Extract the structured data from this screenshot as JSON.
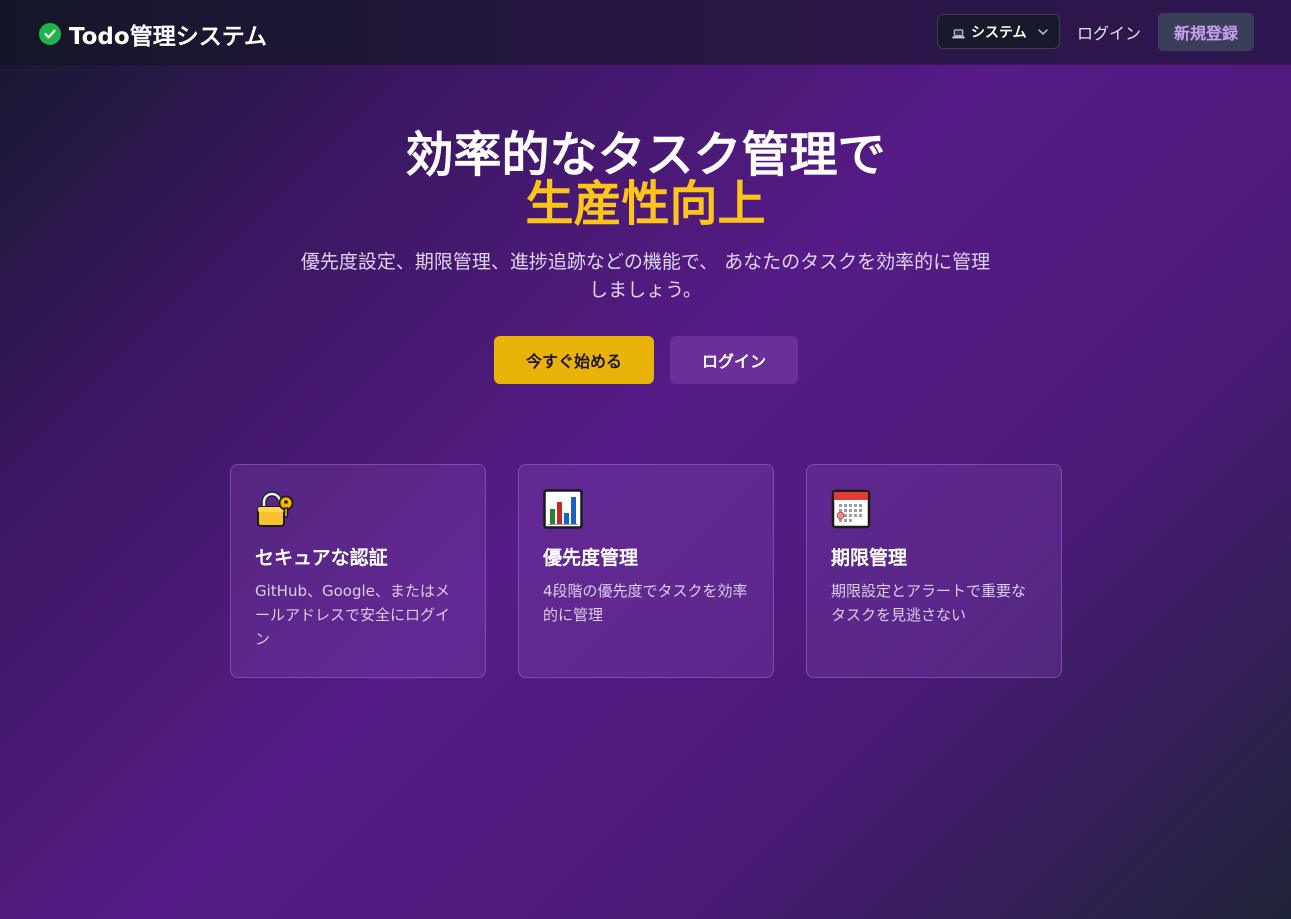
{
  "header": {
    "brand_title": "Todo管理システム",
    "brand_icon": "check-circle-icon",
    "theme_select_value": "システム",
    "theme_select_icon": "laptop-icon",
    "login_label": "ログイン",
    "signup_label": "新規登録"
  },
  "hero": {
    "title_line1": "効率的なタスク管理で",
    "title_line2": "生産性向上",
    "subtitle": "優先度設定、期限管理、進捗追跡などの機能で、 あなたのタスクを効率的に管理しましょう。",
    "primary_button": "今すぐ始める",
    "secondary_button": "ログイン"
  },
  "features": [
    {
      "icon": "lock-with-key-icon",
      "title": "セキュアな認証",
      "description": "GitHub、Google、またはメールアドレスで安全にログイン"
    },
    {
      "icon": "bar-chart-icon",
      "title": "優先度管理",
      "description": "4段階の優先度でタスクを効率的に管理"
    },
    {
      "icon": "calendar-icon",
      "title": "期限管理",
      "description": "期限設定とアラートで重要なタスクを見逃さない"
    }
  ],
  "colors": {
    "accent_yellow": "#eab308",
    "brand_green": "#22b34d",
    "highlight_text": "#fdc517",
    "signup_text": "#c9a0f0"
  }
}
